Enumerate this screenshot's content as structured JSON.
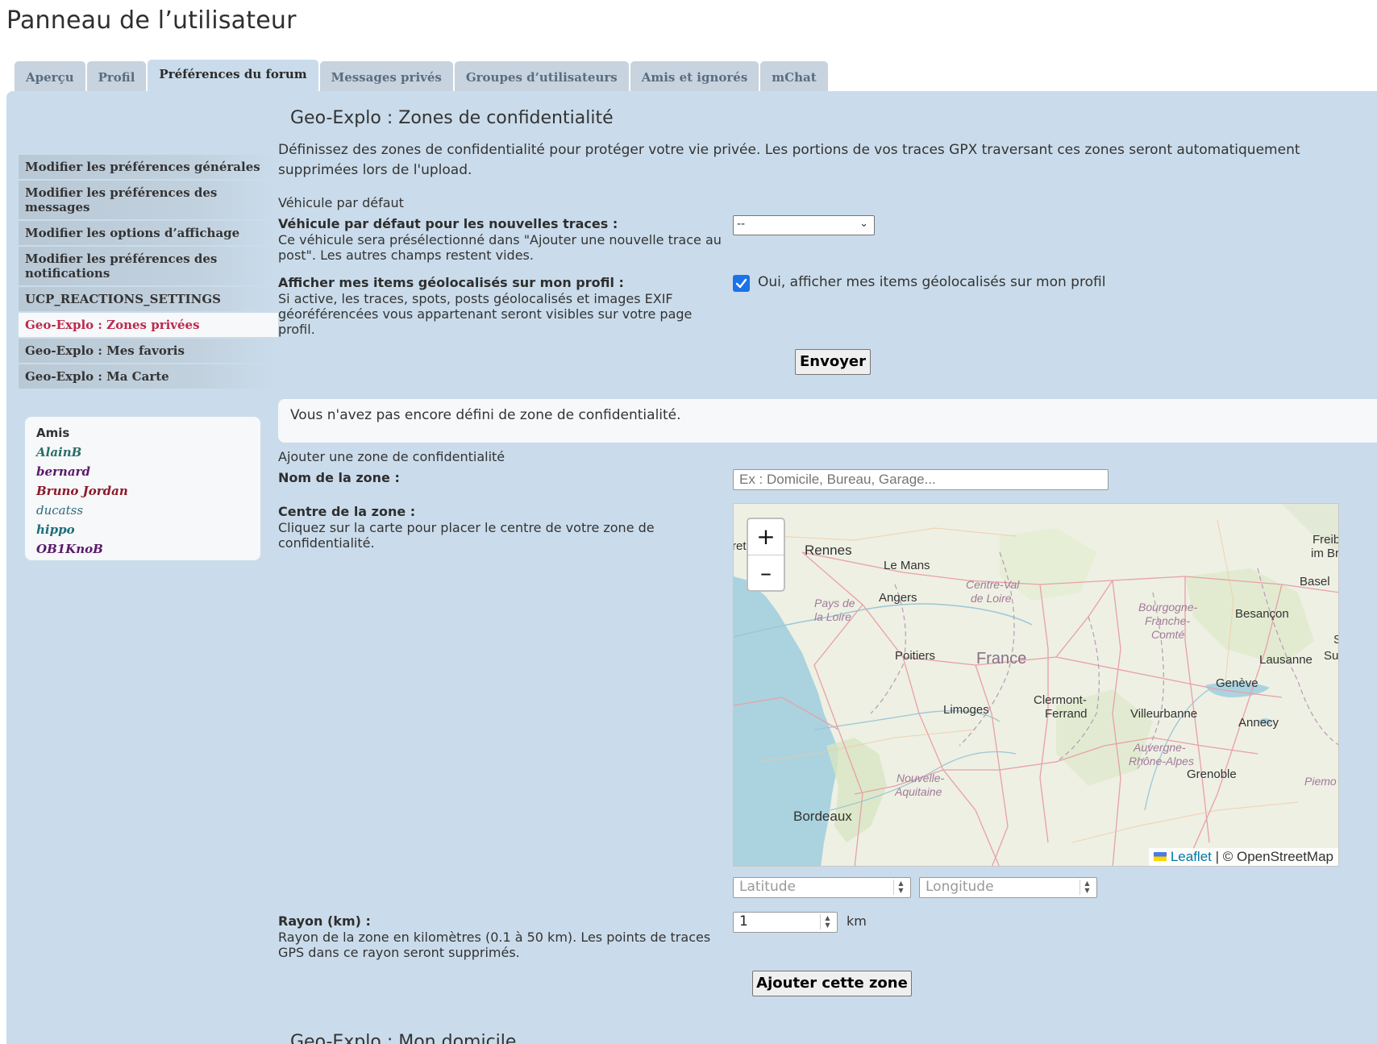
{
  "page": {
    "title": "Panneau de l’utilisateur"
  },
  "tabs": [
    {
      "label": "Aperçu",
      "active": false
    },
    {
      "label": "Profil",
      "active": false
    },
    {
      "label": "Préférences du forum",
      "active": true
    },
    {
      "label": "Messages privés",
      "active": false
    },
    {
      "label": "Groupes d’utilisateurs",
      "active": false
    },
    {
      "label": "Amis et ignorés",
      "active": false
    },
    {
      "label": "mChat",
      "active": false
    }
  ],
  "sidebar": {
    "items": [
      {
        "label": "Modifier les préférences générales"
      },
      {
        "label": "Modifier les préférences des messages"
      },
      {
        "label": "Modifier les options d’affichage"
      },
      {
        "label": "Modifier les préférences des notifications"
      },
      {
        "label": "UCP_REACTIONS_SETTINGS"
      },
      {
        "label": "Geo-Explo : Zones privées",
        "active": true
      },
      {
        "label": "Geo-Explo : Mes favoris"
      },
      {
        "label": "Geo-Explo : Ma Carte"
      }
    ],
    "friends": {
      "title": "Amis",
      "list": [
        {
          "name": "AlainB",
          "color": "#2a6e6a"
        },
        {
          "name": "bernard",
          "color": "#5a1a6a"
        },
        {
          "name": "Bruno Jordan",
          "color": "#8a1a2a"
        },
        {
          "name": "ducatss",
          "color": "#2a6a7a",
          "weight": "normal"
        },
        {
          "name": "hippo",
          "color": "#1a6e7a"
        },
        {
          "name": "OB1KnoB",
          "color": "#5a1a6a"
        }
      ]
    }
  },
  "main": {
    "section_title": "Geo-Explo : Zones de confidentialité",
    "intro": "Définissez des zones de confidentialité pour protéger votre vie privée. Les portions de vos traces GPX traversant ces zones seront automatiquement supprimées lors de l'upload.",
    "vehicle": {
      "legend": "Véhicule par défaut",
      "label": "Véhicule par défaut pour les nouvelles traces :",
      "explain": "Ce véhicule sera présélectionné dans \"Ajouter une nouvelle trace au post\". Les autres champs restent vides.",
      "selected": "--"
    },
    "geo_items": {
      "label": "Afficher mes items géolocalisés sur mon profil :",
      "explain": "Si active, les traces, spots, posts géolocalisés et images EXIF géoréférencées vous appartenant seront visibles sur votre page profil.",
      "checkbox_label": "Oui, afficher mes items géolocalisés sur mon profil",
      "checked": true
    },
    "submit_label": "Envoyer",
    "notice": "Vous n'avez pas encore défini de zone de confidentialité.",
    "add_zone": {
      "legend": "Ajouter une zone de confidentialité",
      "name_label": "Nom de la zone :",
      "name_placeholder": "Ex : Domicile, Bureau, Garage...",
      "center_label": "Centre de la zone :",
      "center_explain": "Cliquez sur la carte pour placer le centre de votre zone de confidentialité.",
      "latitude_placeholder": "Latitude",
      "longitude_placeholder": "Longitude",
      "radius_label": "Rayon (km) :",
      "radius_explain": "Rayon de la zone en kilomètres (0.1 à 50 km). Les points de traces GPS dans ce rayon seront supprimés.",
      "radius_value": "1",
      "radius_unit": "km",
      "submit_label": "Ajouter cette zone"
    },
    "next_section_title": "Geo-Explo : Mon domicile"
  },
  "map": {
    "zoom_in": "+",
    "zoom_out": "–",
    "attribution_link": "Leaflet",
    "attribution_rest": " | © OpenStreetMap",
    "cities": [
      "Rennes",
      "Le Mans",
      "Angers",
      "Poitiers",
      "Limoges",
      "Bordeaux",
      "Besançon",
      "Basel",
      "Lausanne",
      "Genève",
      "Villeurbanne",
      "Annecy",
      "Grenoble",
      "Clermont-",
      "Ferrand",
      "Freibu",
      "im Breis",
      "ret",
      "S",
      "Suiss"
    ],
    "regions": [
      "Centre-Val",
      "de Loire",
      "Pays de",
      "la Loire",
      "Bourgogne-",
      "Franche-",
      "Comté",
      "Nouvelle-",
      "Aquitaine",
      "Auvergne-",
      "Rhône-Alpes",
      "Piemo"
    ],
    "country": "France"
  }
}
